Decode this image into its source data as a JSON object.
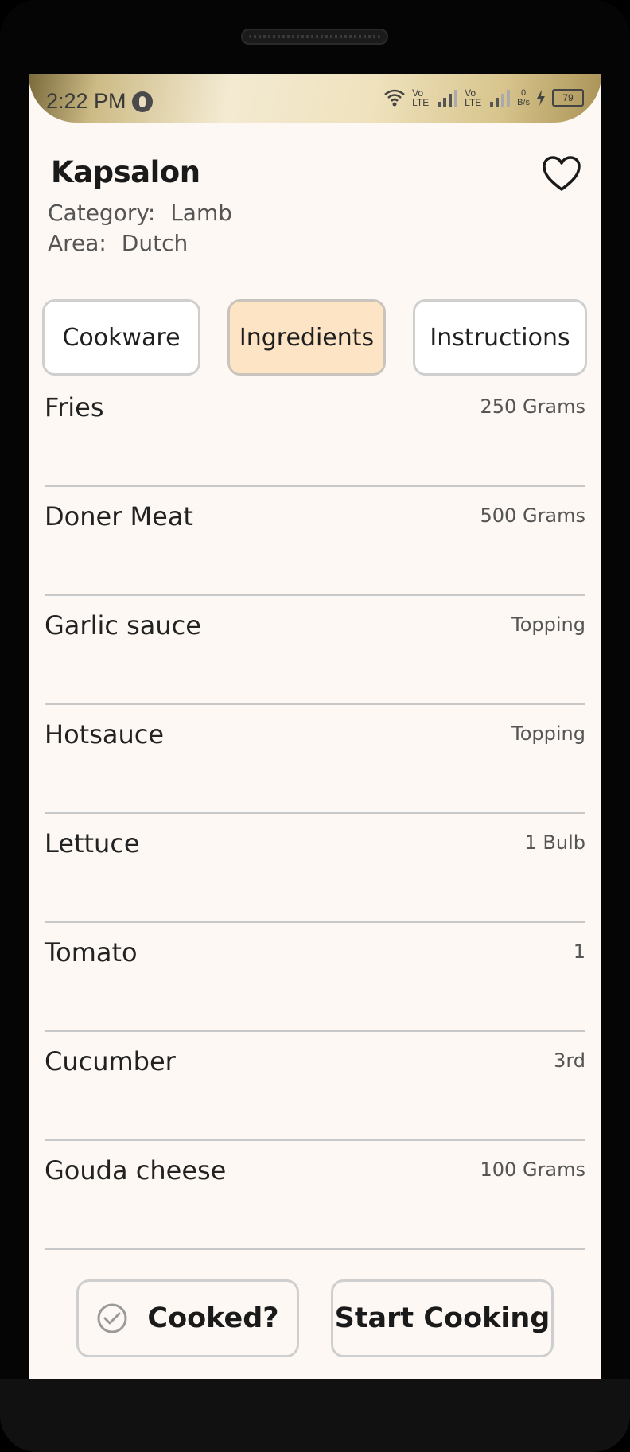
{
  "status_bar": {
    "time": "2:22 PM",
    "net_speed_value": "0",
    "net_speed_unit": "B/s",
    "battery": "79",
    "volte1": "Vo LTE",
    "volte2": "Vo LTE"
  },
  "recipe": {
    "title": "Kapsalon",
    "category_label": "Category:",
    "category_value": "Lamb",
    "area_label": "Area:",
    "area_value": "Dutch"
  },
  "tabs": [
    {
      "label": "Cookware",
      "active": false
    },
    {
      "label": "Ingredients",
      "active": true
    },
    {
      "label": "Instructions",
      "active": false
    }
  ],
  "ingredients": [
    {
      "name": "Fries",
      "qty": "250 Grams"
    },
    {
      "name": "Doner Meat",
      "qty": "500 Grams"
    },
    {
      "name": "Garlic sauce",
      "qty": "Topping"
    },
    {
      "name": "Hotsauce",
      "qty": "Topping"
    },
    {
      "name": "Lettuce",
      "qty": "1 Bulb"
    },
    {
      "name": "Tomato",
      "qty": "1"
    },
    {
      "name": "Cucumber",
      "qty": "3rd"
    },
    {
      "name": "Gouda cheese",
      "qty": "100 Grams"
    }
  ],
  "actions": {
    "cooked_label": "Cooked?",
    "start_label": "Start Cooking"
  },
  "icons": {
    "favorite": "heart-outline-icon",
    "cooked": "check-circle-icon"
  },
  "colors": {
    "background": "#fdf8f3",
    "active_tab": "#fde4c5",
    "border": "#cfcfcf",
    "text": "#1a1a1a"
  }
}
